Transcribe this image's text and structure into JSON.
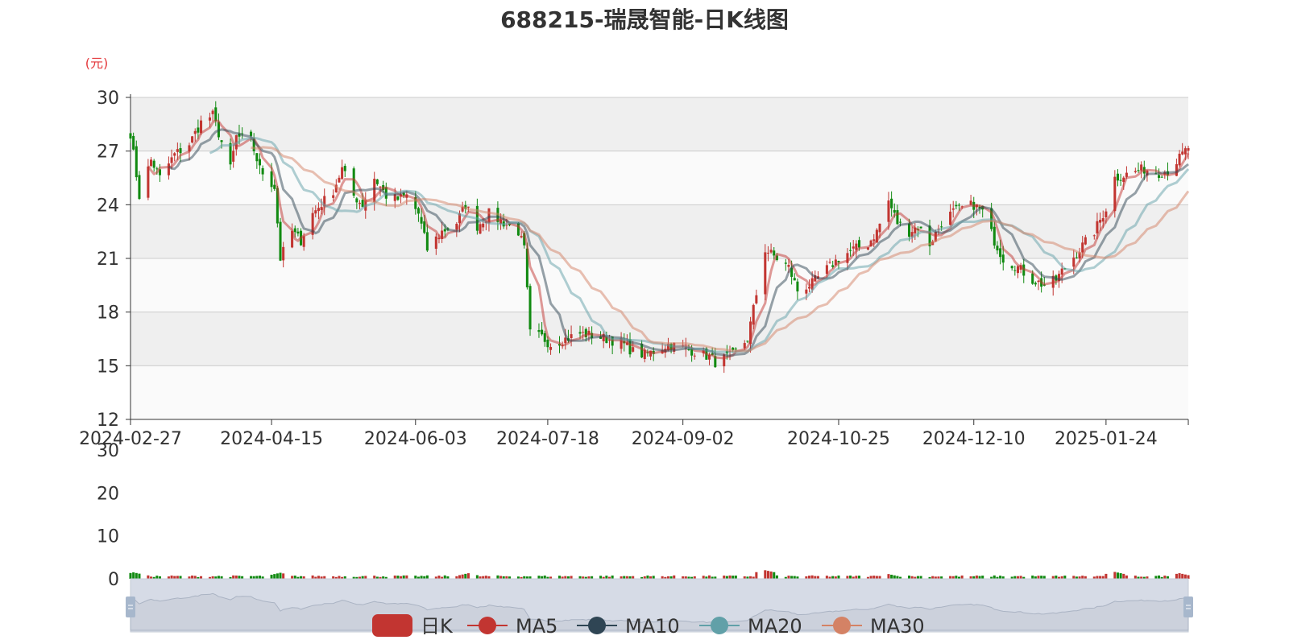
{
  "title": "688215-瑞晟智能-日K线图",
  "colors": {
    "up": "#c23531",
    "down": "#118a11",
    "ma5": "#c23531",
    "ma10": "#2f4554",
    "ma20": "#61a0a8",
    "ma30": "#d48265",
    "unit": "#e4393c",
    "band": "#efefef",
    "gridline": "#cccccc",
    "slider_fill": "#d6dbe6",
    "slider_handle": "#a7b7cc"
  },
  "chart_data": {
    "type": "candlestick",
    "title": "688215-瑞晟智能-日K线图",
    "unit_label": "(元)",
    "price_axis": {
      "ylim": [
        12,
        30
      ],
      "ticks": [
        "30",
        "27",
        "24",
        "21",
        "18",
        "15",
        "12"
      ]
    },
    "volume_axis": {
      "ylim": [
        0,
        30
      ],
      "ticks": [
        "30",
        "20",
        "10",
        "0"
      ]
    },
    "x_range": [
      "2024-02-27",
      "2025-02-21"
    ],
    "date_ticks": [
      "2024-02-27",
      "2024-04-15",
      "2024-06-03",
      "2024-07-18",
      "2024-09-02",
      "2024-10-25",
      "2024-12-10",
      "2025-01-24"
    ],
    "legend": [
      {
        "name": "日K",
        "icon": "candle-icon"
      },
      {
        "name": "MA5",
        "icon": "line-circle-icon"
      },
      {
        "name": "MA10",
        "icon": "line-circle-icon"
      },
      {
        "name": "MA20",
        "icon": "line-circle-icon"
      },
      {
        "name": "MA30",
        "icon": "line-circle-icon"
      }
    ],
    "legend_position": "bottom",
    "close_keypoints": [
      [
        "2024-02-27",
        28.0
      ],
      [
        "2024-03-01",
        24.5
      ],
      [
        "2024-03-05",
        26.5
      ],
      [
        "2024-03-08",
        25.5
      ],
      [
        "2024-03-13",
        26.8
      ],
      [
        "2024-03-18",
        27.4
      ],
      [
        "2024-03-22",
        28.6
      ],
      [
        "2024-03-26",
        29.0
      ],
      [
        "2024-03-28",
        28.0
      ],
      [
        "2024-04-01",
        26.0
      ],
      [
        "2024-04-03",
        27.8
      ],
      [
        "2024-04-08",
        27.6
      ],
      [
        "2024-04-11",
        26.0
      ],
      [
        "2024-04-16",
        25.0
      ],
      [
        "2024-04-18",
        21.0
      ],
      [
        "2024-04-22",
        22.5
      ],
      [
        "2024-04-25",
        22.0
      ],
      [
        "2024-04-29",
        23.5
      ],
      [
        "2024-05-06",
        24.8
      ],
      [
        "2024-05-09",
        26.0
      ],
      [
        "2024-05-13",
        24.5
      ],
      [
        "2024-05-16",
        24.0
      ],
      [
        "2024-05-20",
        25.5
      ],
      [
        "2024-05-24",
        24.5
      ],
      [
        "2024-05-28",
        24.3
      ],
      [
        "2024-05-31",
        24.5
      ],
      [
        "2024-06-04",
        23.5
      ],
      [
        "2024-06-07",
        21.5
      ],
      [
        "2024-06-12",
        22.5
      ],
      [
        "2024-06-17",
        23.0
      ],
      [
        "2024-06-20",
        24.0
      ],
      [
        "2024-06-24",
        22.8
      ],
      [
        "2024-06-28",
        23.5
      ],
      [
        "2024-07-03",
        23.0
      ],
      [
        "2024-07-08",
        22.5
      ],
      [
        "2024-07-10",
        21.5
      ],
      [
        "2024-07-12",
        16.8
      ],
      [
        "2024-07-16",
        16.6
      ],
      [
        "2024-07-19",
        16.2
      ],
      [
        "2024-07-24",
        16.5
      ],
      [
        "2024-07-29",
        16.8
      ],
      [
        "2024-08-02",
        16.7
      ],
      [
        "2024-08-07",
        16.5
      ],
      [
        "2024-08-12",
        16.3
      ],
      [
        "2024-08-16",
        15.8
      ],
      [
        "2024-08-20",
        15.6
      ],
      [
        "2024-08-23",
        15.8
      ],
      [
        "2024-08-28",
        16.2
      ],
      [
        "2024-09-02",
        16.0
      ],
      [
        "2024-09-06",
        15.8
      ],
      [
        "2024-09-11",
        15.5
      ],
      [
        "2024-09-13",
        15.2
      ],
      [
        "2024-09-19",
        15.6
      ],
      [
        "2024-09-24",
        16.5
      ],
      [
        "2024-09-27",
        19.0
      ],
      [
        "2024-09-30",
        21.5
      ],
      [
        "2024-10-08",
        20.5
      ],
      [
        "2024-10-11",
        19.2
      ],
      [
        "2024-10-16",
        19.6
      ],
      [
        "2024-10-21",
        20.4
      ],
      [
        "2024-10-25",
        21.0
      ],
      [
        "2024-10-30",
        21.5
      ],
      [
        "2024-11-04",
        21.8
      ],
      [
        "2024-11-07",
        22.5
      ],
      [
        "2024-11-11",
        24.2
      ],
      [
        "2024-11-14",
        23.0
      ],
      [
        "2024-11-18",
        22.5
      ],
      [
        "2024-11-21",
        22.8
      ],
      [
        "2024-11-25",
        21.8
      ],
      [
        "2024-11-29",
        23.0
      ],
      [
        "2024-12-03",
        23.6
      ],
      [
        "2024-12-06",
        23.8
      ],
      [
        "2024-12-10",
        24.0
      ],
      [
        "2024-12-13",
        23.6
      ],
      [
        "2024-12-17",
        22.0
      ],
      [
        "2024-12-20",
        21.0
      ],
      [
        "2024-12-25",
        20.5
      ],
      [
        "2024-12-30",
        19.8
      ],
      [
        "2025-01-03",
        19.5
      ],
      [
        "2025-01-07",
        19.8
      ],
      [
        "2025-01-10",
        20.5
      ],
      [
        "2025-01-15",
        21.5
      ],
      [
        "2025-01-20",
        22.5
      ],
      [
        "2025-01-24",
        23.8
      ],
      [
        "2025-01-27",
        25.5
      ],
      [
        "2025-02-06",
        26.0
      ],
      [
        "2025-02-11",
        25.8
      ],
      [
        "2025-02-14",
        25.9
      ],
      [
        "2025-02-18",
        26.6
      ],
      [
        "2025-02-21",
        27.2
      ]
    ],
    "volume_spikes": [
      [
        "2024-02-28",
        1.5
      ],
      [
        "2024-04-18",
        1.4
      ],
      [
        "2024-06-21",
        1.3
      ],
      [
        "2024-09-30",
        2.0
      ],
      [
        "2024-11-11",
        1.1
      ],
      [
        "2025-01-27",
        1.6
      ],
      [
        "2025-02-18",
        1.3
      ]
    ]
  }
}
